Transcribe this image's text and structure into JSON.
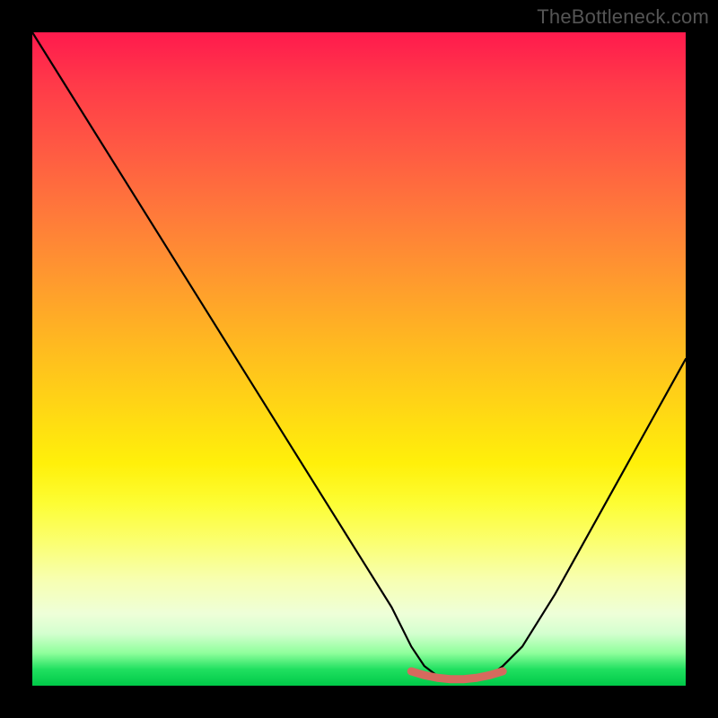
{
  "watermark": "TheBottleneck.com",
  "colors": {
    "frame": "#000000",
    "curve": "#000000",
    "marker": "#d66a5e"
  },
  "chart_data": {
    "type": "line",
    "title": "",
    "xlabel": "",
    "ylabel": "",
    "xlim": [
      0,
      100
    ],
    "ylim": [
      0,
      100
    ],
    "grid": false,
    "legend": false,
    "series": [
      {
        "name": "bottleneck-curve",
        "x": [
          0,
          5,
          10,
          15,
          20,
          25,
          30,
          35,
          40,
          45,
          50,
          55,
          58,
          60,
          62,
          64,
          66,
          68,
          70,
          72,
          75,
          80,
          85,
          90,
          95,
          100
        ],
        "values": [
          100,
          92,
          84,
          76,
          68,
          60,
          52,
          44,
          36,
          28,
          20,
          12,
          6,
          3,
          1.5,
          1,
          1,
          1,
          1.5,
          3,
          6,
          14,
          23,
          32,
          41,
          50
        ]
      },
      {
        "name": "optimal-range-marker",
        "x": [
          58,
          60,
          62,
          64,
          66,
          68,
          70,
          72
        ],
        "values": [
          2.2,
          1.6,
          1.2,
          1.0,
          1.0,
          1.2,
          1.6,
          2.2
        ]
      }
    ],
    "annotations": []
  }
}
